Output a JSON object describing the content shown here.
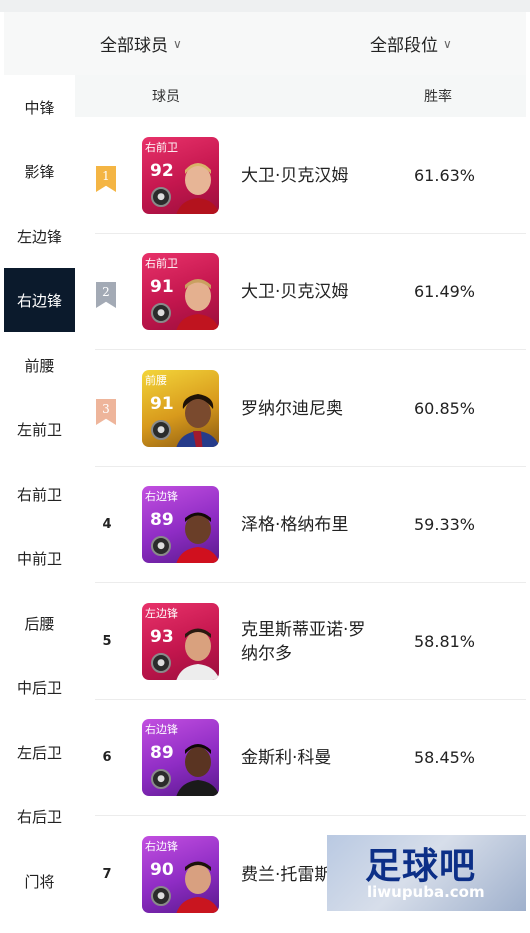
{
  "filters": {
    "players": "全部球员",
    "division": "全部段位"
  },
  "sidebar": {
    "items": [
      "中锋",
      "影锋",
      "左边锋",
      "右边锋",
      "前腰",
      "左前卫",
      "右前卫",
      "中前卫",
      "后腰",
      "中后卫",
      "左后卫",
      "右后卫",
      "门将"
    ],
    "active_index": 3
  },
  "table": {
    "col_player": "球员",
    "col_winrate": "胜率"
  },
  "rows": [
    {
      "rank": "1",
      "position": "右前卫",
      "rating": "92",
      "name": "大卫·贝克汉姆",
      "winrate": "61.63%"
    },
    {
      "rank": "2",
      "position": "右前卫",
      "rating": "91",
      "name": "大卫·贝克汉姆",
      "winrate": "61.49%"
    },
    {
      "rank": "3",
      "position": "前腰",
      "rating": "91",
      "name": "罗纳尔迪尼奥",
      "winrate": "60.85%"
    },
    {
      "rank": "4",
      "position": "右边锋",
      "rating": "89",
      "name": "泽格·格纳布里",
      "winrate": "59.33%"
    },
    {
      "rank": "5",
      "position": "左边锋",
      "rating": "93",
      "name": "克里斯蒂亚诺·罗纳尔多",
      "winrate": "58.81%"
    },
    {
      "rank": "6",
      "position": "右边锋",
      "rating": "89",
      "name": "金斯利·科曼",
      "winrate": "58.45%"
    },
    {
      "rank": "7",
      "position": "右边锋",
      "rating": "90",
      "name": "费兰·托雷斯",
      "winrate": ""
    }
  ],
  "colors": {
    "active_sidebar": "#0b1a2c",
    "gold": "#f4b544",
    "silver": "#a3aab5",
    "bronze": "#eeb59b"
  },
  "watermark": {
    "title": "足球吧",
    "url": "liwupuba.com"
  }
}
